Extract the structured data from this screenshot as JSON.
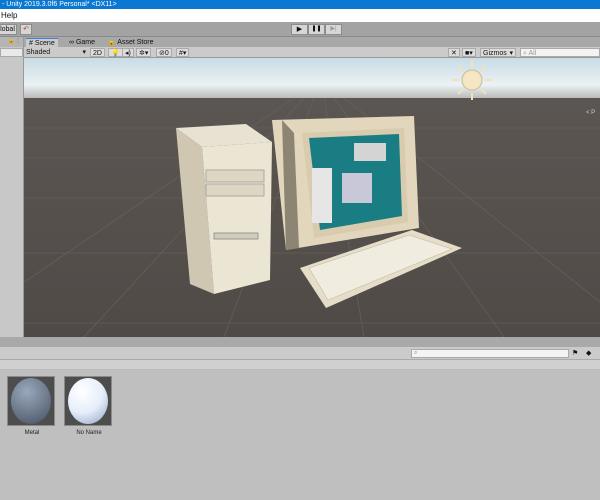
{
  "window": {
    "title": "- Unity 2019.3.0f6 Personal* <DX11>"
  },
  "menu": {
    "items": [
      "Help"
    ]
  },
  "toolbar": {
    "global_label": "lobal",
    "play": "▶",
    "pause": "❚❚",
    "step": "▶|"
  },
  "tabs": [
    {
      "label": "Scene",
      "icon": "scene-icon"
    },
    {
      "label": "Game",
      "icon": "game-icon"
    },
    {
      "label": "Asset Store",
      "icon": "store-icon"
    }
  ],
  "scene_toolbar": {
    "shading": "Shaded",
    "mode_2d": "2D",
    "hidden_count": "0",
    "gizmos": "Gizmos",
    "search_placeholder": "All",
    "persp_label": "< P"
  },
  "project": {
    "search_placeholder": "",
    "assets": [
      {
        "name": "Metal"
      },
      {
        "name": "No Name"
      }
    ]
  }
}
